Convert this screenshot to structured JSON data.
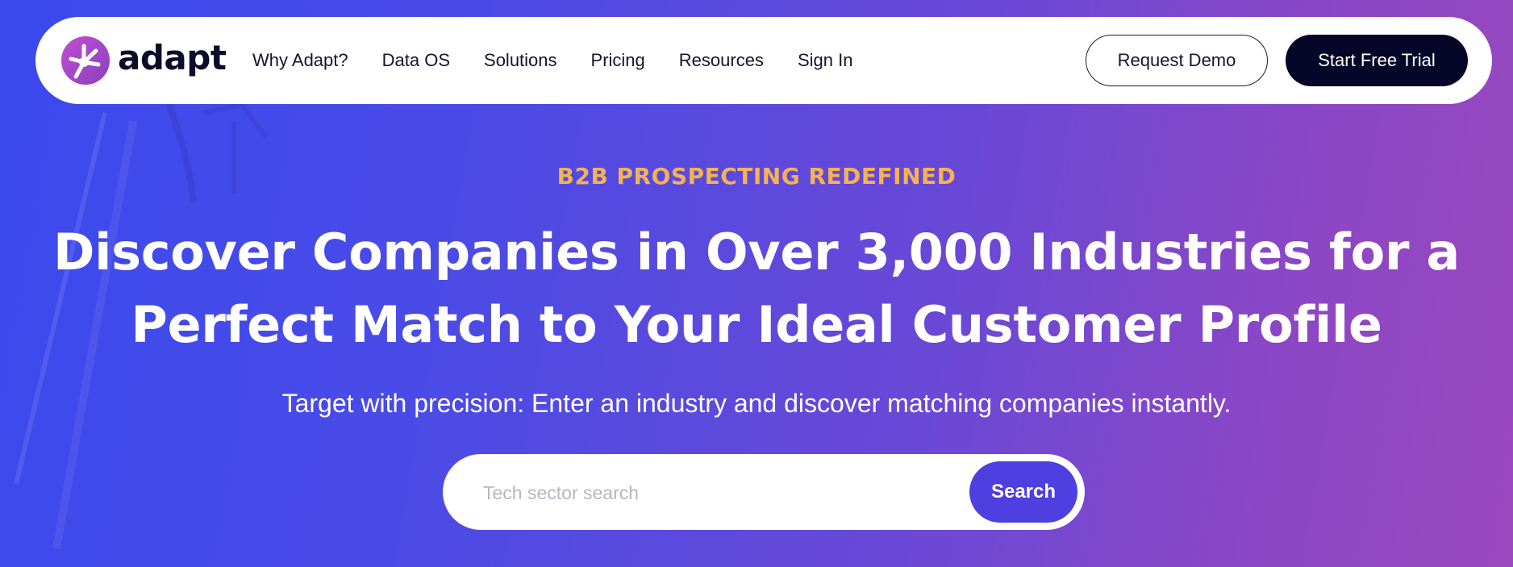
{
  "brand": {
    "name": "adapt",
    "logo_icon": "adapt-starburst-icon",
    "logo_color": "#a447c8"
  },
  "nav": {
    "links": [
      "Why Adapt?",
      "Data OS",
      "Solutions",
      "Pricing",
      "Resources",
      "Sign In"
    ],
    "request_demo_label": "Request Demo",
    "start_trial_label": "Start Free Trial"
  },
  "hero": {
    "eyebrow": "B2B PROSPECTING REDEFINED",
    "headline_line1": "Discover Companies in Over 3,000 Industries for a",
    "headline_line2": "Perfect Match to Your Ideal Customer Profile",
    "subheadline": "Target with precision: Enter an industry and discover matching companies instantly."
  },
  "search": {
    "placeholder": "Tech sector search",
    "value": "",
    "button_label": "Search"
  },
  "colors": {
    "eyebrow": "#f4b254",
    "gradient_start": "#3b49ee",
    "gradient_end": "#9a48be",
    "trial_button": "#050628",
    "search_button": "#4f3ee0"
  }
}
